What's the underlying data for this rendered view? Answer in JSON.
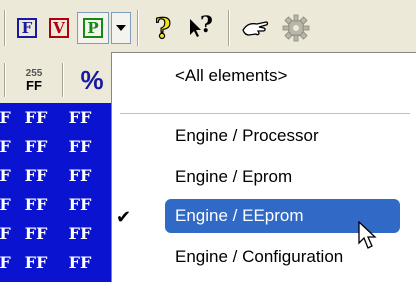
{
  "toolbar": {
    "buttons": [
      {
        "icon": "f-box-icon",
        "letter": "F",
        "color": "#1a1aa0"
      },
      {
        "icon": "v-box-icon",
        "letter": "V",
        "color": "#b00010"
      },
      {
        "icon": "p-box-icon",
        "letter": "P",
        "color": "#138a13"
      }
    ],
    "dropdown_icon": "chevron-down-icon",
    "help_icon": "question-mark-icon",
    "context_help_icon": "context-help-icon",
    "context_help_label": "?",
    "help_label": "?",
    "hand_icon": "hand-icon",
    "gear_icon": "gear-icon"
  },
  "left_toolbar": {
    "hex_255_top": "255",
    "hex_255_bottom": "FF",
    "percent_label": "%"
  },
  "hex_grid": {
    "rows": [
      [
        "F",
        "FF",
        "FF"
      ],
      [
        "F",
        "FF",
        "FF"
      ],
      [
        "F",
        "FF",
        "FF"
      ],
      [
        "F",
        "FF",
        "FF"
      ],
      [
        "F",
        "FF",
        "FF"
      ],
      [
        "F",
        "FF",
        "FF"
      ]
    ]
  },
  "menu": {
    "all_label": "<All elements>",
    "items": [
      {
        "label": "Engine / Processor",
        "checked": false,
        "selected": false
      },
      {
        "label": "Engine / Eprom",
        "checked": false,
        "selected": false
      },
      {
        "label": "Engine / EEprom",
        "checked": true,
        "selected": true
      },
      {
        "label": "Engine / Configuration",
        "checked": false,
        "selected": false
      }
    ],
    "check_mark": "✔"
  },
  "colors": {
    "selection": "#3169c6",
    "grid_bg": "#0a14d0"
  }
}
